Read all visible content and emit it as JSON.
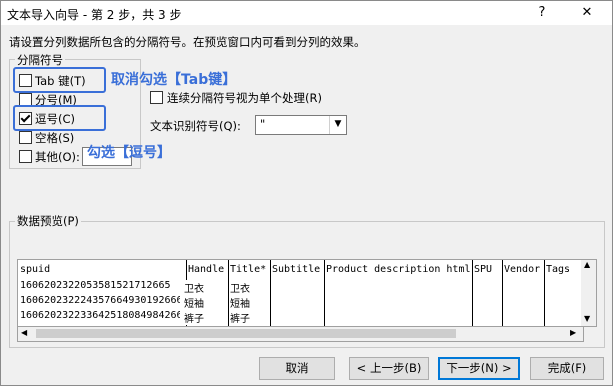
{
  "window": {
    "title": "文本导入向导 - 第 2 步，共 3 步",
    "help": "?",
    "close": "✕"
  },
  "instruction": "请设置分列数据所包含的分隔符号。在预览窗口内可看到分列的效果。",
  "delimiters": {
    "legend": "分隔符号",
    "tab": {
      "label": "Tab 键(T)",
      "checked": false
    },
    "semicolon": {
      "label": "分号(M)",
      "checked": false
    },
    "comma": {
      "label": "逗号(C)",
      "checked": true
    },
    "space": {
      "label": "空格(S)",
      "checked": false
    },
    "other": {
      "label": "其他(O):",
      "checked": false,
      "value": ""
    }
  },
  "consecutive": {
    "label": "连续分隔符号视为单个处理(R)",
    "checked": false
  },
  "text_qualifier": {
    "label": "文本识别符号(Q):",
    "value": "\""
  },
  "annotations": {
    "tab": "取消勾选【Tab键】",
    "comma": "勾选【逗号】"
  },
  "preview": {
    "label": "数据预览(P)",
    "columns": [
      "spuid",
      "Handle",
      "Title*",
      "Subtitle",
      "Product description html",
      "SPU",
      "Vendor",
      "Tags"
    ],
    "rows": [
      [
        "1606202322053581521712665",
        "卫衣",
        "卫衣",
        "",
        "",
        "",
        "",
        ""
      ],
      [
        "1606202322243576649301926665",
        "短袖",
        "短袖",
        "",
        "",
        "",
        "",
        ""
      ],
      [
        "1606202322336425180849842665",
        "裤子",
        "裤子",
        "",
        "",
        "",
        "",
        ""
      ]
    ]
  },
  "buttons": {
    "cancel": "取消",
    "back": "< 上一步(B)",
    "next": "下一步(N) >",
    "finish": "完成(F)"
  }
}
